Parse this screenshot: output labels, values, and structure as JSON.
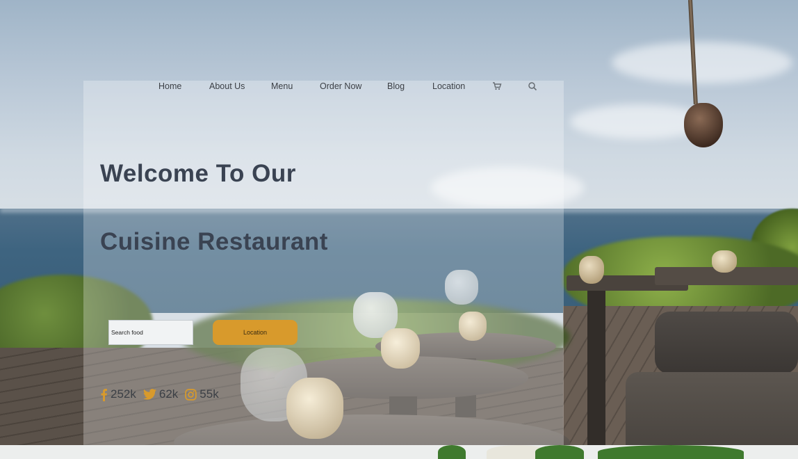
{
  "nav": {
    "links": [
      "Home",
      "About Us",
      "Menu",
      "Order Now",
      "Blog",
      "Location"
    ],
    "icons": [
      "cart-icon",
      "search-icon"
    ]
  },
  "hero": {
    "title_line1": "Welcome To Our",
    "title_line2": "Cuisine Restaurant",
    "search_placeholder": "Search food",
    "location_button": "Location"
  },
  "social": {
    "facebook": {
      "icon": "facebook-icon",
      "count": "252k"
    },
    "twitter": {
      "icon": "twitter-icon",
      "count": "62k"
    },
    "instagram": {
      "icon": "instagram-icon",
      "count": "55k"
    }
  },
  "colors": {
    "accent": "#d89a2c",
    "social_icon": "#d89a2c",
    "title": "#3a4352",
    "text": "#3b3f45"
  }
}
